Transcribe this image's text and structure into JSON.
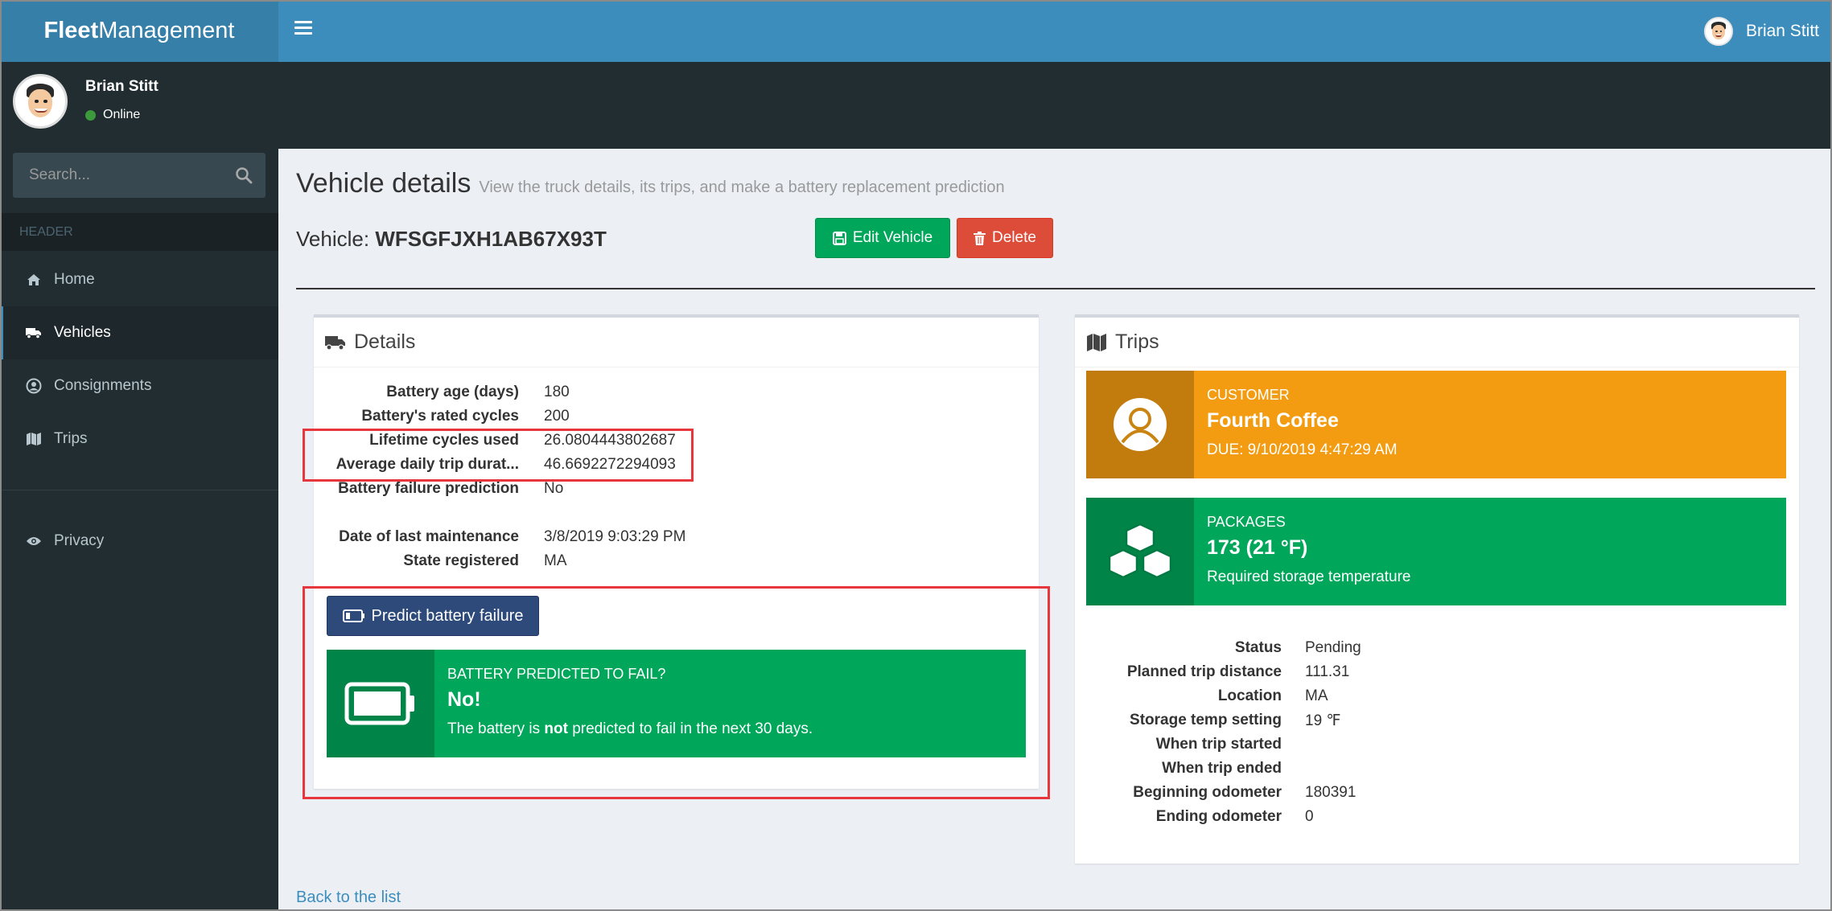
{
  "app": {
    "logo_bold": "Fleet",
    "logo_rest": "Management"
  },
  "topbar": {
    "user_name": "Brian Stitt"
  },
  "sidebar": {
    "user_name": "Brian Stitt",
    "user_status": "Online",
    "search_placeholder": "Search...",
    "header_label": "HEADER",
    "items": [
      {
        "label": "Home",
        "icon": "home-icon"
      },
      {
        "label": "Vehicles",
        "icon": "truck-icon"
      },
      {
        "label": "Consignments",
        "icon": "user-circle-icon"
      },
      {
        "label": "Trips",
        "icon": "map-icon"
      }
    ],
    "secondary_items": [
      {
        "label": "Privacy",
        "icon": "eye-icon"
      }
    ],
    "active_item": "Vehicles"
  },
  "page": {
    "title": "Vehicle details",
    "subtitle": "View the truck details, its trips, and make a battery replacement prediction",
    "vehicle_label": "Vehicle:",
    "vehicle_id": "WFSGFJXH1AB67X93T",
    "edit_label": "Edit Vehicle",
    "delete_label": "Delete",
    "back_link": "Back to the list"
  },
  "details": {
    "heading": "Details",
    "rows": [
      {
        "label": "Battery age (days)",
        "value": "180"
      },
      {
        "label": "Battery's rated cycles",
        "value": "200"
      },
      {
        "label": "Lifetime cycles used",
        "value": "26.0804443802687"
      },
      {
        "label": "Average daily trip durat...",
        "value": "46.6692272294093"
      },
      {
        "label": "Battery failure prediction",
        "value": "No"
      }
    ],
    "rows2": [
      {
        "label": "Date of last maintenance",
        "value": "3/8/2019 9:03:29 PM"
      },
      {
        "label": "State registered",
        "value": "MA"
      }
    ],
    "predict_button": "Predict battery failure",
    "prediction": {
      "title": "BATTERY PREDICTED TO FAIL?",
      "answer": "No!",
      "desc_before": "The battery is ",
      "desc_bold": "not",
      "desc_after": " predicted to fail in the next 30 days."
    }
  },
  "trips": {
    "heading": "Trips",
    "customer": {
      "label": "CUSTOMER",
      "name": "Fourth Coffee",
      "due": "DUE: 9/10/2019 4:47:29 AM"
    },
    "packages": {
      "label": "PACKAGES",
      "value": "173 (21 °F)",
      "desc": "Required storage temperature"
    },
    "rows": [
      {
        "label": "Status",
        "value": "Pending"
      },
      {
        "label": "Planned trip distance",
        "value": "111.31"
      },
      {
        "label": "Location",
        "value": "MA"
      },
      {
        "label": "Storage temp setting",
        "value": "19 ℉"
      },
      {
        "label": "When trip started",
        "value": ""
      },
      {
        "label": "When trip ended",
        "value": ""
      },
      {
        "label": "Beginning odometer",
        "value": "180391"
      },
      {
        "label": "Ending odometer",
        "value": "0"
      }
    ]
  },
  "colors": {
    "header": "#3c8dbc",
    "sidebar": "#222d32",
    "success": "#00a65a",
    "danger": "#dd4b39",
    "warning": "#f39c12",
    "primary_dark": "#2d4a7a",
    "highlight": "#e8363d"
  }
}
